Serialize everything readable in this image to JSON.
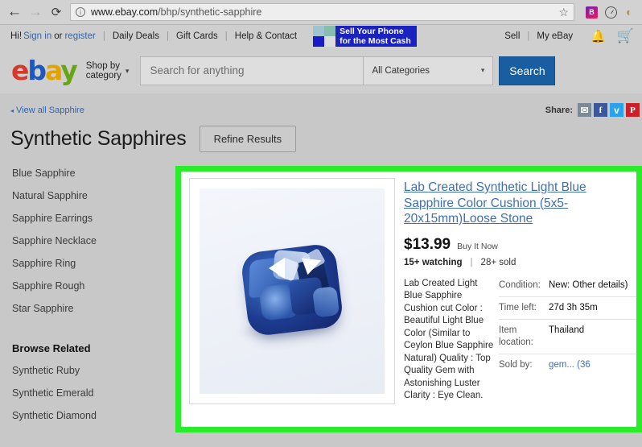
{
  "browser": {
    "back_icon": "back-arrow-icon",
    "forward_icon": "forward-arrow-icon",
    "reload_icon": "reload-icon",
    "info_glyph": "i",
    "url_host": "www.ebay.com",
    "url_path": "/bhp/synthetic-sapphire",
    "star_glyph": "☆",
    "extension_badge": "B",
    "profile_glyph": "◜"
  },
  "globalnav": {
    "greeting": "Hi!",
    "signin": "Sign in",
    "or": "or",
    "register": "register",
    "links": [
      "Daily Deals",
      "Gift Cards",
      "Help & Contact"
    ],
    "banner_line1": "Sell Your Phone",
    "banner_line2": "for the Most Cash",
    "sell": "Sell",
    "myebay": "My eBay",
    "bell_icon": "notifications-bell-icon",
    "cart_icon": "shopping-cart-icon"
  },
  "header": {
    "logo": {
      "e": "e",
      "b": "b",
      "a": "a",
      "y": "y"
    },
    "shop_by_line1": "Shop by",
    "shop_by_line2": "category",
    "caret": "▾",
    "search_placeholder": "Search for anything",
    "category_selected": "All Categories",
    "search_button": "Search"
  },
  "page": {
    "breadcrumb": "View all Sapphire",
    "breadcrumb_caret": "◂",
    "title": "Synthetic Sapphires",
    "refine_button": "Refine Results",
    "share_label": "Share:",
    "share_icons": [
      {
        "name": "email-share-icon",
        "glyph": "✉"
      },
      {
        "name": "facebook-share-icon",
        "glyph": "f"
      },
      {
        "name": "twitter-share-icon",
        "glyph": "ᴠ"
      },
      {
        "name": "pinterest-share-icon",
        "glyph": "P"
      }
    ]
  },
  "sidebar": {
    "links": [
      "Blue Sapphire",
      "Natural Sapphire",
      "Sapphire Earrings",
      "Sapphire Necklace",
      "Sapphire Ring",
      "Sapphire Rough",
      "Star Sapphire"
    ],
    "browse_related_heading": "Browse Related",
    "related_links": [
      "Synthetic Ruby",
      "Synthetic Emerald",
      "Synthetic Diamond"
    ]
  },
  "listing": {
    "title": "Lab Created Synthetic Light Blue Sapphire Color Cushion (5x5-20x15mm)Loose Stone",
    "price": "$13.99",
    "buy_format": "Buy It Now",
    "watching": "15+ watching",
    "separator": "|",
    "sold_count": "28+ sold",
    "description": "Lab Created Light Blue Sapphire Cushion cut Color : Beautiful Light Blue Color (Similar to Ceylon Blue Sapphire Natural) Quality : Top Quality Gem with Astonishing Luster Clarity : Eye Clean.",
    "image_alt": "blue cushion cut sapphire gemstone",
    "specs": [
      {
        "key": "Condition:",
        "value": "New: Other details)",
        "is_link": false
      },
      {
        "key": "Time left:",
        "value": "27d 3h 35m",
        "is_link": false
      },
      {
        "key": "Item location:",
        "value": "Thailand",
        "is_link": false
      },
      {
        "key": "Sold by:",
        "value": "gem...   (36",
        "is_link": true
      }
    ]
  },
  "colors": {
    "highlight_green": "#2bec2b",
    "ebay_blue": "#195ea1",
    "link_blue": "#3f6fb5",
    "page_bg": "#c8c8c8"
  }
}
